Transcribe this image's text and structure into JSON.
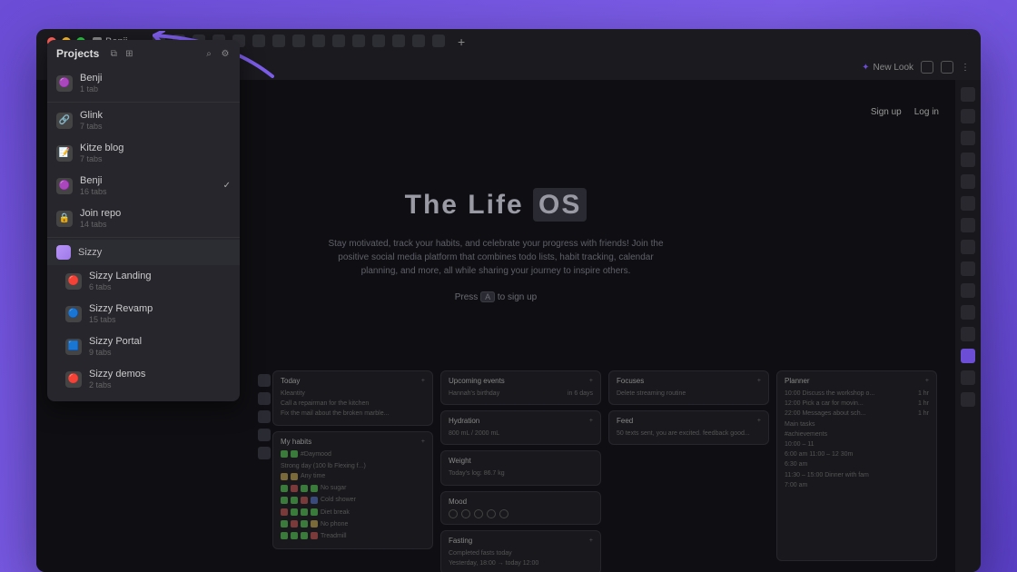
{
  "titlebar": {
    "tab_name": "Benji"
  },
  "chrome": {
    "new_look": "New Look"
  },
  "panel": {
    "title": "Projects",
    "projects": [
      {
        "name": "Benji",
        "sub": "1 tab",
        "icon": "🟣"
      },
      {
        "name": "Glink",
        "sub": "7 tabs",
        "icon": "🔗"
      },
      {
        "name": "Kitze blog",
        "sub": "7 tabs",
        "icon": "📝"
      },
      {
        "name": "Benji",
        "sub": "16 tabs",
        "icon": "🟣",
        "checked": true
      },
      {
        "name": "Join repo",
        "sub": "14 tabs",
        "icon": "🔒"
      }
    ],
    "group": "Sizzy",
    "subprojects": [
      {
        "name": "Sizzy Landing",
        "sub": "6 tabs",
        "icon": "🔴"
      },
      {
        "name": "Sizzy Revamp",
        "sub": "15 tabs",
        "icon": "🔵"
      },
      {
        "name": "Sizzy Portal",
        "sub": "9 tabs",
        "icon": "🟦"
      },
      {
        "name": "Sizzy demos",
        "sub": "2 tabs",
        "icon": "🔴"
      }
    ]
  },
  "hero": {
    "signup": "Sign up",
    "login": "Log in",
    "title_pre": "The  Life  ",
    "title_pill": "OS",
    "desc": "Stay motivated, track your habits, and celebrate your progress with friends! Join the positive social media platform that combines todo lists, habit tracking, calendar planning, and more, all while sharing your journey to inspire others.",
    "cta_pre": "Press ",
    "cta_key": "A",
    "cta_post": " to sign up"
  },
  "cards": {
    "today": {
      "title": "Today",
      "lines": [
        "Kleantity",
        "Call a repairman for the kitchen",
        "Fix the mail about the broken marble..."
      ]
    },
    "habits": {
      "title": "My habits",
      "h1": "#Daymood",
      "h1s": "Strong day (100 lb Flexing f...)",
      "h2": "Any time",
      "rows": [
        "No sugar",
        "Cold shower",
        "Diet break",
        "No phone",
        "Treadmill"
      ]
    },
    "upcoming": {
      "title": "Upcoming events",
      "line": "Hannah's birthday",
      "meta": "in 6 days"
    },
    "hydration": {
      "title": "Hydration",
      "line": "800 mL / 2000 mL"
    },
    "weight": {
      "title": "Weight",
      "line": "Today's log: 86.7 kg"
    },
    "mood": {
      "title": "Mood"
    },
    "fasting": {
      "title": "Fasting",
      "l1": "Completed fasts today",
      "l2": "Yesterday, 18:00 → today 12:00"
    },
    "focuses": {
      "title": "Focuses",
      "line": "Delete streaming routine"
    },
    "feed": {
      "title": "Feed",
      "line": "50 texts sent, you are excited. feedback good..."
    },
    "planner": {
      "title": "Planner",
      "rows": [
        {
          "t": "10:00",
          "txt": "Discuss the workshop o...",
          "d": "1 hr"
        },
        {
          "t": "12:00",
          "txt": "Pick a car for movin...",
          "d": "1 hr"
        },
        {
          "t": "22:00",
          "txt": "Messages about sch...",
          "d": "1 hr"
        },
        {
          "t": "",
          "txt": "Main tasks",
          "d": ""
        },
        {
          "t": "",
          "txt": "#achievements",
          "d": ""
        },
        {
          "t": "10:00 – 11",
          "txt": "",
          "d": ""
        },
        {
          "t": "6:00 am",
          "txt": "11:00 – 12  30m",
          "d": ""
        },
        {
          "t": "6:30 am",
          "txt": "",
          "d": ""
        },
        {
          "t": "",
          "txt": "11:30 – 15:00  Dinner with fam",
          "d": ""
        },
        {
          "t": "7:00 am",
          "txt": "",
          "d": ""
        }
      ]
    }
  }
}
